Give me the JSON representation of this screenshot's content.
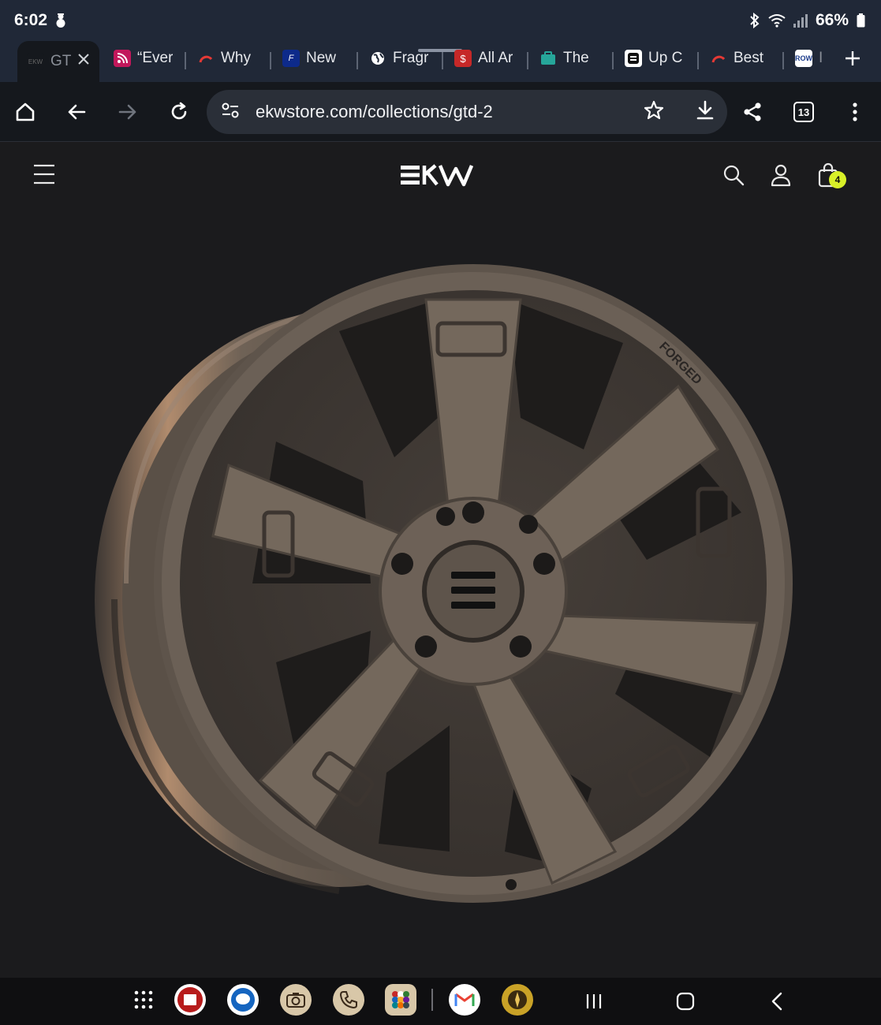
{
  "status_bar": {
    "time": "6:02",
    "battery": "66%"
  },
  "tabs": [
    {
      "label": "GT",
      "favicon": "ekw-logo-icon",
      "active": true
    },
    {
      "label": "“Ever",
      "favicon": "feed-icon"
    },
    {
      "label": "Why",
      "favicon": "red-arc-icon"
    },
    {
      "label": "New",
      "favicon": "ford-icon"
    },
    {
      "label": "Fragr",
      "favicon": "globe-icon"
    },
    {
      "label": "All Ar",
      "favicon": "red-book-icon"
    },
    {
      "label": "The",
      "favicon": "teal-bag-icon"
    },
    {
      "label": "Up C",
      "favicon": "square-logo-icon"
    },
    {
      "label": "Best",
      "favicon": "red-arc-icon"
    },
    {
      "label": "I",
      "favicon": "blue-badge-icon"
    }
  ],
  "toolbar": {
    "url": "ekwstore.com/collections/gtd-2",
    "tab_count": "13"
  },
  "site": {
    "logo_text": "EKW",
    "cart_count": "4",
    "product_image_alt": "forged wheel",
    "wheel_stamp": "FORGED",
    "accent": "#d8f028"
  },
  "dock": {
    "apps": [
      "apps-grid-icon",
      "bible-app-icon",
      "messages-icon",
      "camera-icon",
      "phone-icon",
      "folder-icon",
      "gmail-icon",
      "compass-icon"
    ]
  },
  "colors": {
    "status_bg": "#202837",
    "toolbar_bg": "#15181d",
    "page_bg": "#1b1b1d",
    "wheel_bronze": "#6e6256"
  }
}
